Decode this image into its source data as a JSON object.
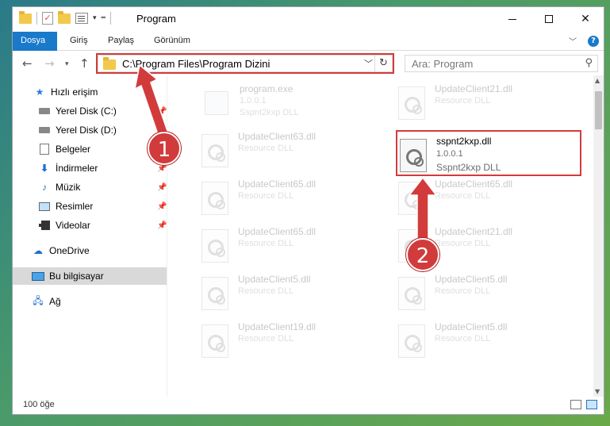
{
  "window": {
    "title": "Program"
  },
  "ribbon": {
    "tabs": [
      "Dosya",
      "Giriş",
      "Paylaş",
      "Görünüm"
    ],
    "active_tab": "Dosya"
  },
  "address": {
    "path": "C:\\Program Files\\Program Dizini",
    "search_placeholder": "Ara: Program"
  },
  "sidebar": {
    "items": [
      {
        "label": "Hızlı erişim",
        "icon": "star-icon"
      },
      {
        "label": "Yerel Disk (C:)",
        "icon": "drive-icon",
        "pinned": true
      },
      {
        "label": "Yerel Disk (D:)",
        "icon": "drive-icon"
      },
      {
        "label": "Belgeler",
        "icon": "documents-icon",
        "pinned": true
      },
      {
        "label": "İndirmeler",
        "icon": "download-icon",
        "pinned": true
      },
      {
        "label": "Müzik",
        "icon": "music-icon",
        "pinned": true
      },
      {
        "label": "Resimler",
        "icon": "pictures-icon",
        "pinned": true
      },
      {
        "label": "Videolar",
        "icon": "videos-icon",
        "pinned": true
      },
      {
        "label": "OneDrive",
        "icon": "cloud-icon"
      },
      {
        "label": "Bu bilgisayar",
        "icon": "computer-icon",
        "selected": true
      },
      {
        "label": "Ağ",
        "icon": "network-icon"
      }
    ]
  },
  "files": [
    {
      "name": "program.exe",
      "line2": "1.0.0.1",
      "line3": "Sspnt2kxp DLL",
      "type": "exe",
      "faded": true
    },
    {
      "name": "UpdateClient21.dll",
      "line2": "Resource DLL",
      "type": "dll",
      "faded": true
    },
    {
      "name": "UpdateClient63.dll",
      "line2": "Resource DLL",
      "type": "dll",
      "faded": true
    },
    {
      "name": "sspnt2kxp.dll",
      "line2": "1.0.0.1",
      "line3": "Sspnt2kxp DLL",
      "type": "dll",
      "faded": false
    },
    {
      "name": "UpdateClient65.dll",
      "line2": "Resource DLL",
      "type": "dll",
      "faded": true
    },
    {
      "name": "UpdateClient65.dll",
      "line2": "Resource DLL",
      "type": "dll",
      "faded": true
    },
    {
      "name": "UpdateClient65.dll",
      "line2": "Resource DLL",
      "type": "dll",
      "faded": true
    },
    {
      "name": "UpdateClient21.dll",
      "line2": "Resource DLL",
      "type": "dll",
      "faded": true
    },
    {
      "name": "UpdateClient5.dll",
      "line2": "Resource DLL",
      "type": "dll",
      "faded": true
    },
    {
      "name": "UpdateClient5.dll",
      "line2": "Resource DLL",
      "type": "dll",
      "faded": true
    },
    {
      "name": "UpdateClient19.dll",
      "line2": "Resource DLL",
      "type": "dll",
      "faded": true
    },
    {
      "name": "UpdateClient5.dll",
      "line2": "Resource DLL",
      "type": "dll",
      "faded": true
    }
  ],
  "status": {
    "item_count": "100 öğe"
  },
  "annotations": {
    "badge1": "1",
    "badge2": "2",
    "color": "#d23b3b"
  }
}
